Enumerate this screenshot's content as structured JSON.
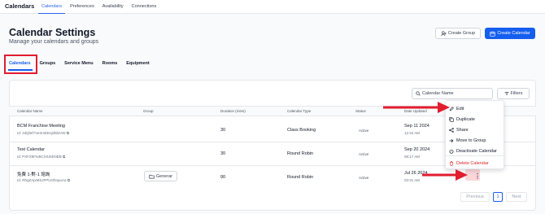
{
  "app": {
    "title": "Calendars"
  },
  "topnav": [
    {
      "label": "Calendars",
      "active": true
    },
    {
      "label": "Preferences",
      "active": false
    },
    {
      "label": "Availability",
      "active": false
    },
    {
      "label": "Connections",
      "active": false
    }
  ],
  "header": {
    "title": "Calendar Settings",
    "subtitle": "Manage your calendars and groups",
    "create_group_label": "Create Group",
    "create_calendar_label": "Create Calendar"
  },
  "tabs": [
    {
      "label": "Calendars",
      "active": true
    },
    {
      "label": "Groups",
      "active": false
    },
    {
      "label": "Service Menu",
      "active": false
    },
    {
      "label": "Rooms",
      "active": false
    },
    {
      "label": "Equipment",
      "active": false
    }
  ],
  "toolbar": {
    "search_placeholder": "Calendar Name",
    "filters_label": "Filters"
  },
  "table": {
    "columns": [
      "Calendar Name",
      "Group",
      "Duration (mins)",
      "Calendar Type",
      "Status",
      "Date Updated"
    ],
    "rows": [
      {
        "name": "BCM Franchise Meeting",
        "id": "Id: JdQfef7VeXmEEnj0bbIVW",
        "group": "",
        "duration": "30",
        "type": "Class Booking",
        "status": "Active",
        "date": "Sep 11 2024",
        "time": "12:34 AM"
      },
      {
        "name": "Test Calendar",
        "id": "Id: PXFZ8FIvBCXIUkENEB",
        "group": "",
        "duration": "30",
        "type": "Round Robin",
        "status": "Active",
        "date": "Sep 20 2024",
        "time": "08:17 AM"
      },
      {
        "name": "免費 1-對-1 諮詢",
        "id": "Id: RhqZAjxMSJFPUOhnpuAa",
        "group": "Generar",
        "duration": "90",
        "type": "Round Robin",
        "status": "Active",
        "date": "Jul 26 2024",
        "time": "03:31 AM"
      }
    ]
  },
  "menu": {
    "items": [
      {
        "label": "Edit",
        "icon": "pencil-icon"
      },
      {
        "label": "Duplicate",
        "icon": "copy-icon"
      },
      {
        "label": "Share",
        "icon": "share-icon"
      },
      {
        "label": "Move to Group",
        "icon": "arrow-right-icon"
      },
      {
        "label": "Deactivate Calendar",
        "icon": "power-icon"
      },
      {
        "label": "Delete Calendar",
        "icon": "trash-icon"
      }
    ]
  },
  "pagination": {
    "previous": "Previous",
    "page": "1",
    "next": "Next"
  },
  "colors": {
    "accent": "#155eef",
    "annotation": "#e11d2e"
  }
}
